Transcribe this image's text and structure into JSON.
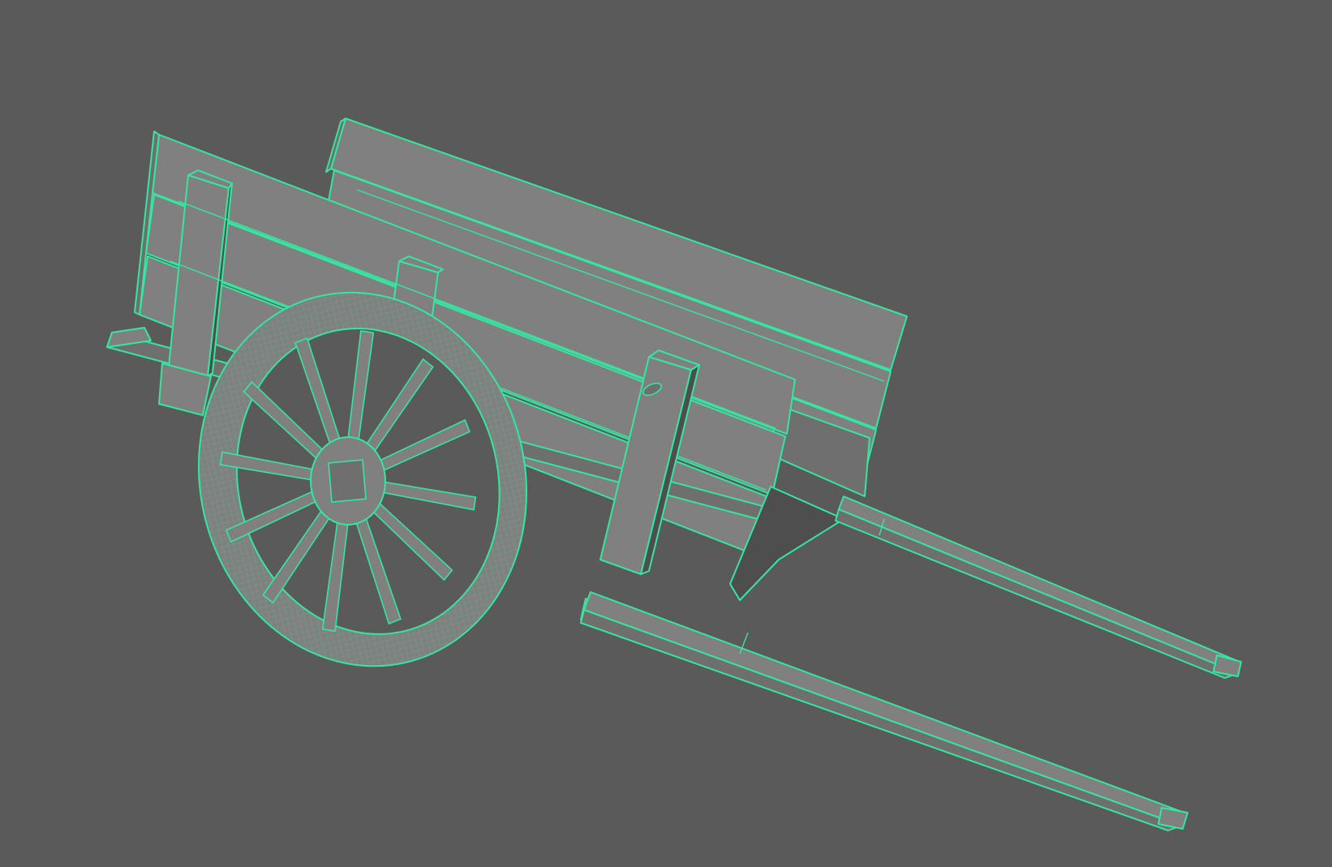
{
  "viewport": {
    "background": "#5a5a5a",
    "mode": "wireframe-on-shaded"
  },
  "model": {
    "object": "cart-mesh",
    "shading_color": "#808080",
    "side_color": "#6f6f6f",
    "dark_color": "#4e4e4e",
    "wire_color": "#35e6a0"
  }
}
